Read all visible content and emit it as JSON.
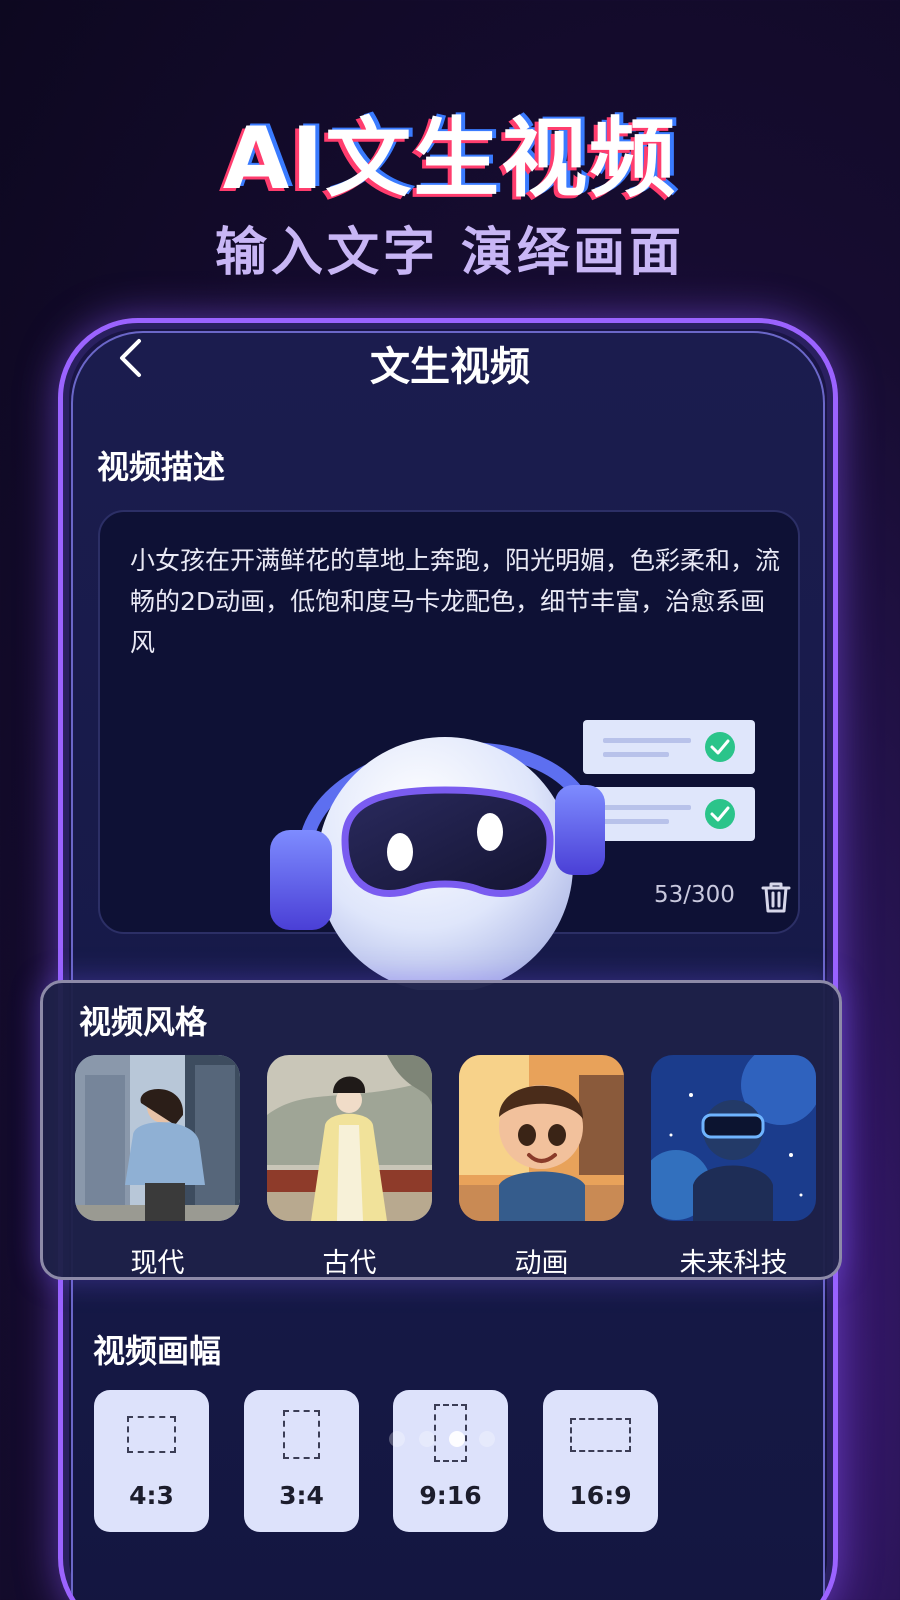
{
  "hero": {
    "title": "AI文生视频",
    "subtitle": "输入文字 演绎画面"
  },
  "nav": {
    "back_icon": "chevron-left-icon",
    "title": "文生视频"
  },
  "description": {
    "label": "视频描述",
    "text": "小女孩在开满鲜花的草地上奔跑，阳光明媚，色彩柔和，流畅的2D动画，低饱和度马卡龙配色，细节丰富，治愈系画风",
    "char_count": "53/300",
    "delete_icon": "trash-icon"
  },
  "style": {
    "label": "视频风格",
    "items": [
      {
        "label": "现代"
      },
      {
        "label": "古代"
      },
      {
        "label": "动画"
      },
      {
        "label": "未来科技"
      }
    ]
  },
  "ratio": {
    "label": "视频画幅",
    "items": [
      {
        "label": "4:3"
      },
      {
        "label": "3:4"
      },
      {
        "label": "9:16"
      },
      {
        "label": "16:9"
      }
    ]
  },
  "carousel": {
    "dot_count": 4,
    "active_index": 2
  },
  "colors": {
    "accent_purple": "#9b63ff",
    "check_green": "#2bc48a",
    "ratio_button_bg": "#dde2fb"
  }
}
